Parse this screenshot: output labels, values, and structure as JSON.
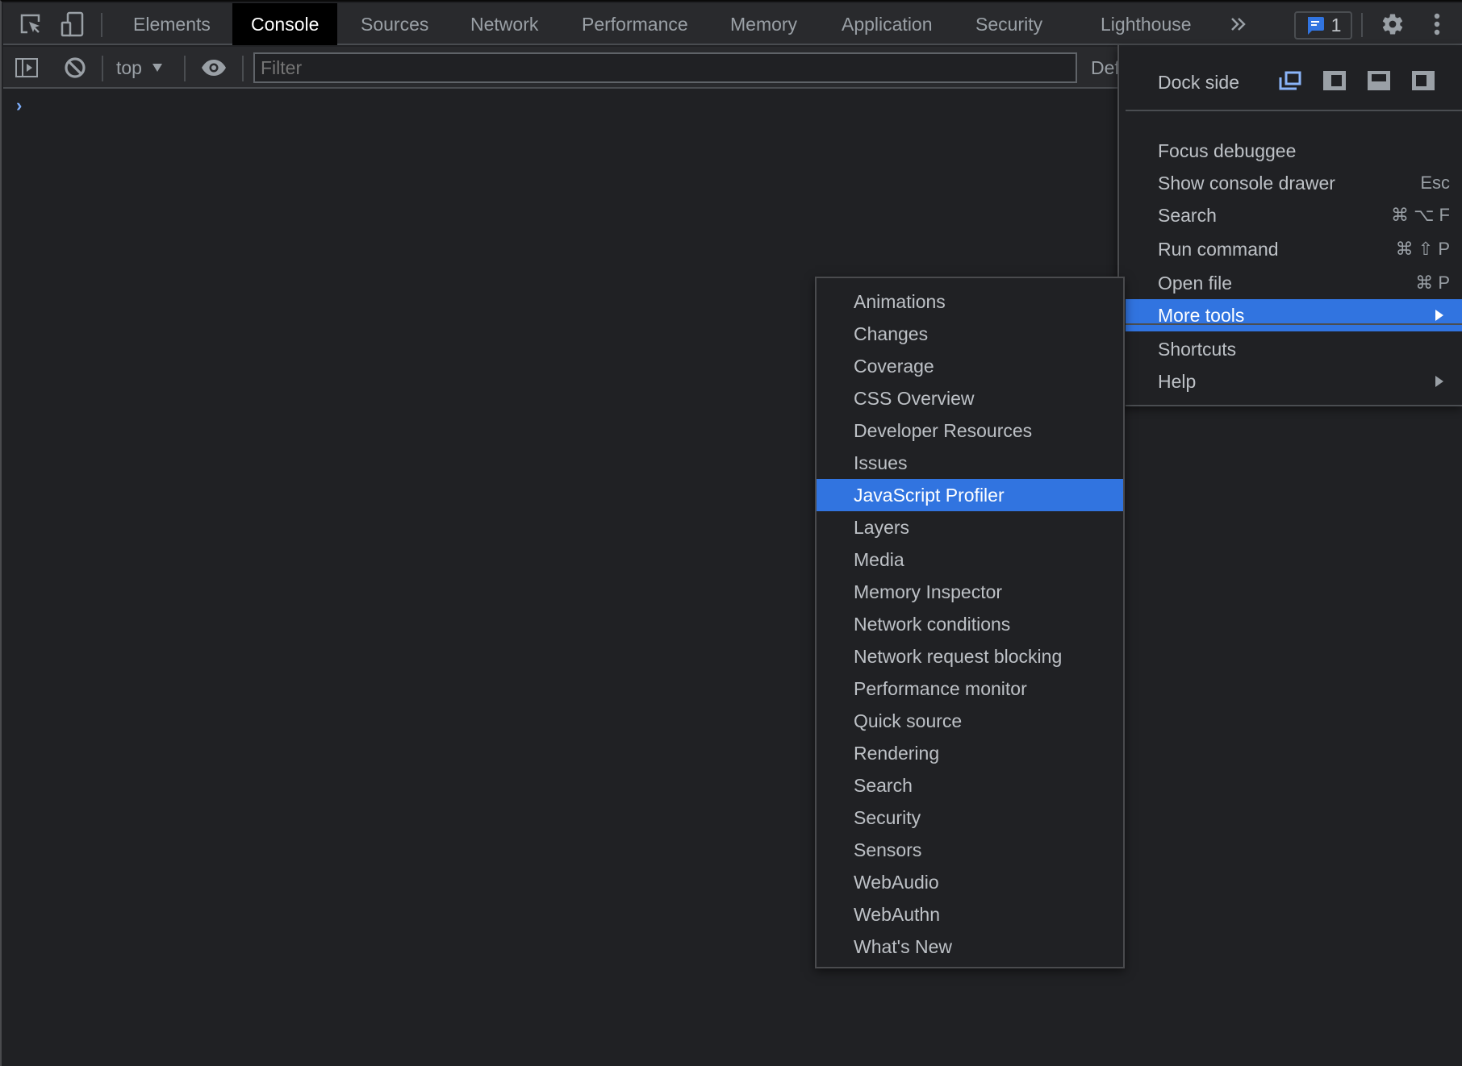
{
  "tabbar": {
    "tabs": [
      {
        "label": "Elements",
        "active": false
      },
      {
        "label": "Console",
        "active": true
      },
      {
        "label": "Sources",
        "active": false
      },
      {
        "label": "Network",
        "active": false
      },
      {
        "label": "Performance",
        "active": false
      },
      {
        "label": "Memory",
        "active": false
      },
      {
        "label": "Application",
        "active": false
      },
      {
        "label": "Security",
        "active": false
      },
      {
        "label": "Lighthouse",
        "active": false
      }
    ],
    "overflow_icon": "chevron-double-right",
    "issues_count": "1",
    "issues_icon": "message-icon",
    "settings_icon": "gear-icon",
    "more_icon": "kebab-icon"
  },
  "toolbar": {
    "context_value": "top",
    "filter_placeholder": "Filter",
    "levels_label": "Def"
  },
  "console": {
    "prompt": "›"
  },
  "main_menu": {
    "dock_side_label": "Dock side",
    "dock_options": [
      "undock",
      "dock-left",
      "dock-bottom",
      "dock-right"
    ],
    "dock_selected": "undock",
    "items": [
      {
        "label": "Focus debuggee",
        "shortcut": ""
      },
      {
        "label": "Show console drawer",
        "shortcut": "Esc"
      },
      {
        "label": "Search",
        "shortcut": "⌘ ⌥ F"
      },
      {
        "label": "Run command",
        "shortcut": "⌘ ⇧ P"
      },
      {
        "label": "Open file",
        "shortcut": "⌘ P"
      },
      {
        "label": "More tools",
        "shortcut": "",
        "submenu": true,
        "highlighted": true
      }
    ],
    "items2": [
      {
        "label": "Shortcuts"
      },
      {
        "label": "Help",
        "submenu": true
      }
    ]
  },
  "more_tools_submenu": {
    "highlighted": "JavaScript Profiler",
    "items": [
      "Animations",
      "Changes",
      "Coverage",
      "CSS Overview",
      "Developer Resources",
      "Issues",
      "JavaScript Profiler",
      "Layers",
      "Media",
      "Memory Inspector",
      "Network conditions",
      "Network request blocking",
      "Performance monitor",
      "Quick source",
      "Rendering",
      "Search",
      "Security",
      "Sensors",
      "WebAudio",
      "WebAuthn",
      "What's New"
    ]
  },
  "colors": {
    "accent": "#3174e0",
    "background": "#202124",
    "toolbar": "#292a2d",
    "text": "#bdc1c6",
    "muted": "#9aa0a6",
    "prompt": "#7cacf8"
  }
}
